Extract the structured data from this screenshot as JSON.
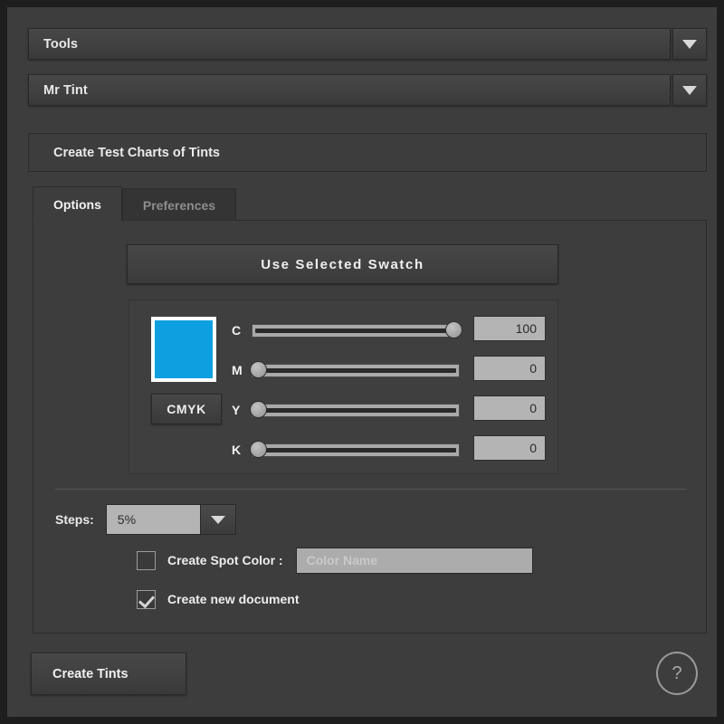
{
  "window": {
    "background_color": "#3d3d3d",
    "border_color": "#1e1e1e"
  },
  "top_dropdowns": [
    {
      "label": "Tools",
      "arrow_icon": "chevron-down-icon"
    },
    {
      "label": "Mr Tint",
      "arrow_icon": "chevron-down-icon"
    }
  ],
  "title_bar": {
    "text": "Create Test Charts of Tints"
  },
  "tabs": [
    {
      "label": "Options",
      "active": true
    },
    {
      "label": "Preferences",
      "active": false
    }
  ],
  "options": {
    "use_selected_swatch_label": "Use Selected Swatch",
    "color_preview": {
      "hex": "#0d9fe0",
      "border_hex": "#ffffff"
    },
    "color_mode_button": "CMYK",
    "sliders": [
      {
        "label": "C",
        "value": 100,
        "max": 100
      },
      {
        "label": "M",
        "value": 0,
        "max": 100
      },
      {
        "label": "Y",
        "value": 0,
        "max": 100
      },
      {
        "label": "K",
        "value": 0,
        "max": 100
      }
    ],
    "steps": {
      "label": "Steps:",
      "value": "5%",
      "arrow_icon": "chevron-down-icon"
    },
    "spot_color": {
      "label": "Create Spot Color :",
      "checked": false,
      "name_placeholder": "Color Name",
      "name_value": ""
    },
    "new_document": {
      "label": "Create new document",
      "checked": true
    }
  },
  "footer": {
    "create_button_label": "Create Tints",
    "help_icon_glyph": "?"
  }
}
